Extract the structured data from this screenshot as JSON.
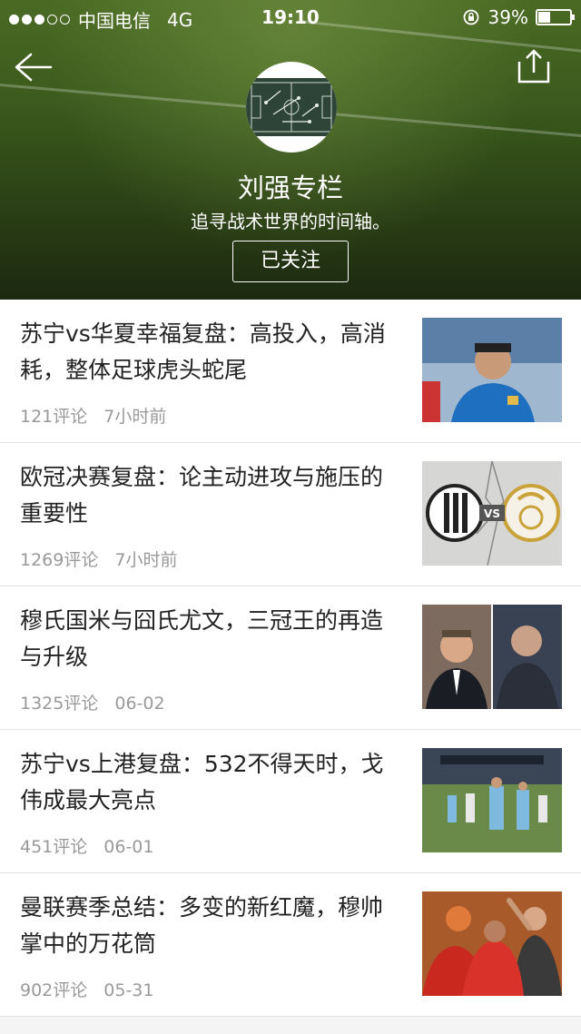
{
  "status_bar": {
    "carrier": "中国电信",
    "network": "4G",
    "time": "19:10",
    "battery": "39%",
    "battery_level": 0.39
  },
  "header": {
    "back_icon": "arrow-left-icon",
    "share_icon": "share-icon",
    "title": "刘强专栏",
    "subtitle": "追寻战术世界的时间轴。",
    "follow_label": "已关注"
  },
  "articles": [
    {
      "title": "苏宁vs华夏幸福复盘：高投入，高消耗，整体足球虎头蛇尾",
      "comments": "121评论",
      "time": "7小时前",
      "thumb_accent": "#1e6fc0"
    },
    {
      "title": "欧冠决赛复盘：论主动进攻与施压的重要性",
      "comments": "1269评论",
      "time": "7小时前",
      "thumb_accent": "#c9a23a"
    },
    {
      "title": "穆氏国米与囧氏尤文，三冠王的再造与升级",
      "comments": "1325评论",
      "time": "06-02",
      "thumb_accent": "#2a2f3a"
    },
    {
      "title": "苏宁vs上港复盘：532不得天时，戈伟成最大亮点",
      "comments": "451评论",
      "time": "06-01",
      "thumb_accent": "#7fb9e0"
    },
    {
      "title": "曼联赛季总结：多变的新红魔，穆帅掌中的万花筒",
      "comments": "902评论",
      "time": "05-31",
      "thumb_accent": "#c8281e"
    }
  ]
}
